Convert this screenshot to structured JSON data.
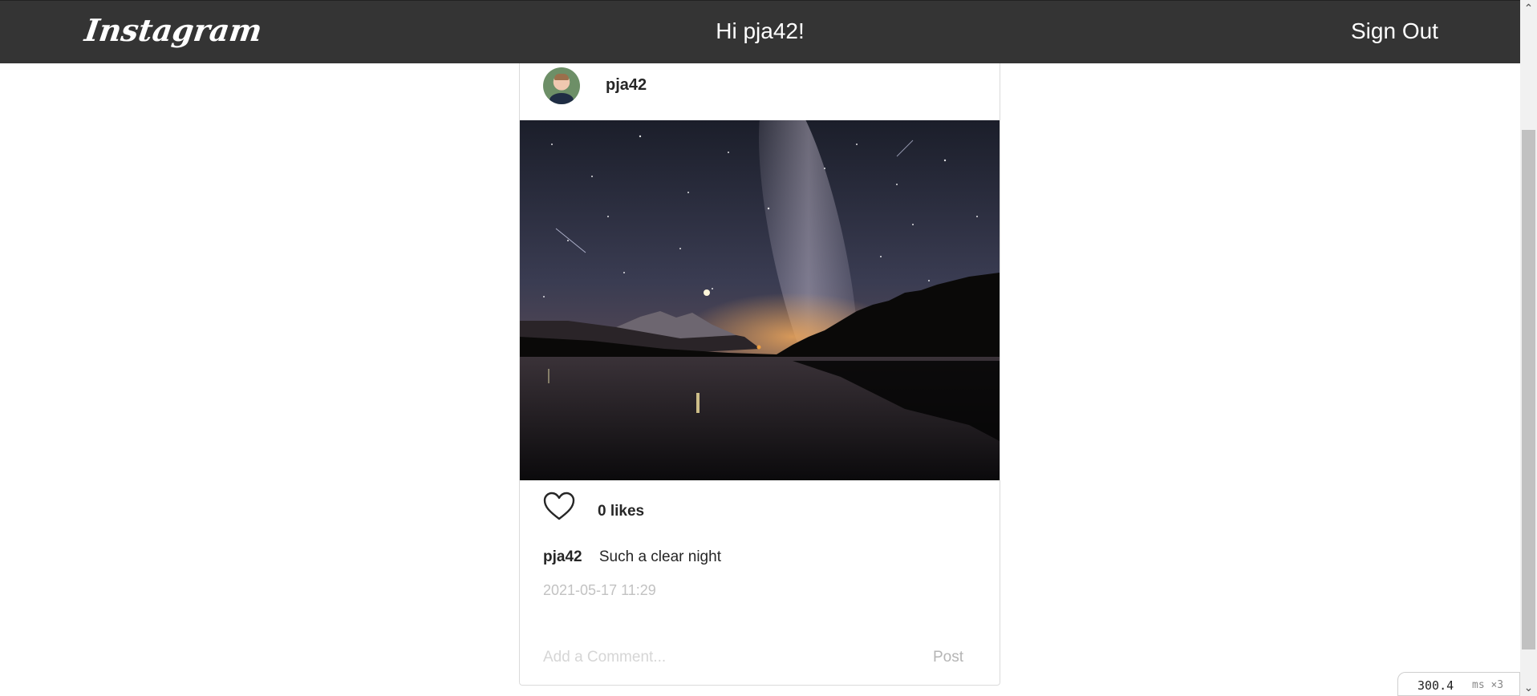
{
  "navbar": {
    "logo": "Instagram",
    "greeting": "Hi pja42!",
    "signout_label": "Sign Out"
  },
  "post": {
    "username": "pja42",
    "likes_text": "0 likes",
    "caption_user": "pja42",
    "caption_text": "Such a clear night",
    "timestamp": "2021-05-17 11:29",
    "comment_placeholder": "Add a Comment...",
    "post_label": "Post"
  },
  "overlay": {
    "perf_value": "300.4",
    "perf_unit": "ms ×3"
  },
  "icons": {
    "heart": "heart-icon",
    "avatar": "avatar",
    "scroll_up": "chevron-up-icon",
    "scroll_down": "chevron-down-icon"
  },
  "colors": {
    "navbar": "#343434",
    "card_border": "#dbdbdb",
    "muted_text": "#c2c2c2"
  }
}
